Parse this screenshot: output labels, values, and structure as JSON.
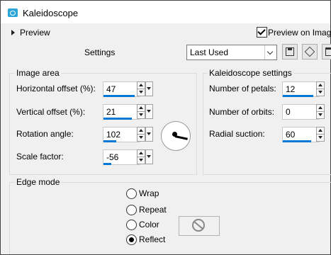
{
  "window": {
    "title": "Kaleidoscope",
    "icon": "kaleidoscope-app-icon"
  },
  "preview": {
    "label": "Preview",
    "on_image_label": "Preview on Image",
    "on_image_checked": true
  },
  "settings": {
    "label": "Settings",
    "preset_value": "Last Used",
    "toolbar_icons": [
      "save-preset-icon",
      "preset-cube-icon",
      "printer-icon"
    ]
  },
  "image_area": {
    "title": "Image area",
    "fields": [
      {
        "label": "Horizontal offset (%):",
        "value": "47",
        "level": 0.87
      },
      {
        "label": "Vertical offset (%):",
        "value": "21",
        "level": 0.8
      },
      {
        "label": "Rotation angle:",
        "value": "102",
        "level": 0.35
      },
      {
        "label": "Scale factor:",
        "value": "-56",
        "level": 0.22
      }
    ]
  },
  "kaleidoscope_settings": {
    "title": "Kaleidoscope settings",
    "fields": [
      {
        "label": "Number of petals:",
        "value": "12",
        "level": 0.85
      },
      {
        "label": "Number of orbits:",
        "value": "0",
        "level": 0.0
      },
      {
        "label": "Radial suction:",
        "value": "60",
        "level": 0.8
      }
    ]
  },
  "edge_mode": {
    "title": "Edge mode",
    "options": [
      {
        "label": "Wrap",
        "selected": false
      },
      {
        "label": "Repeat",
        "selected": false
      },
      {
        "label": "Color",
        "selected": false
      },
      {
        "label": "Reflect",
        "selected": true
      }
    ]
  },
  "colors": {
    "accent": "#0078d7",
    "app_icon": "#2aa5d8",
    "background": "#f0f0f0"
  }
}
